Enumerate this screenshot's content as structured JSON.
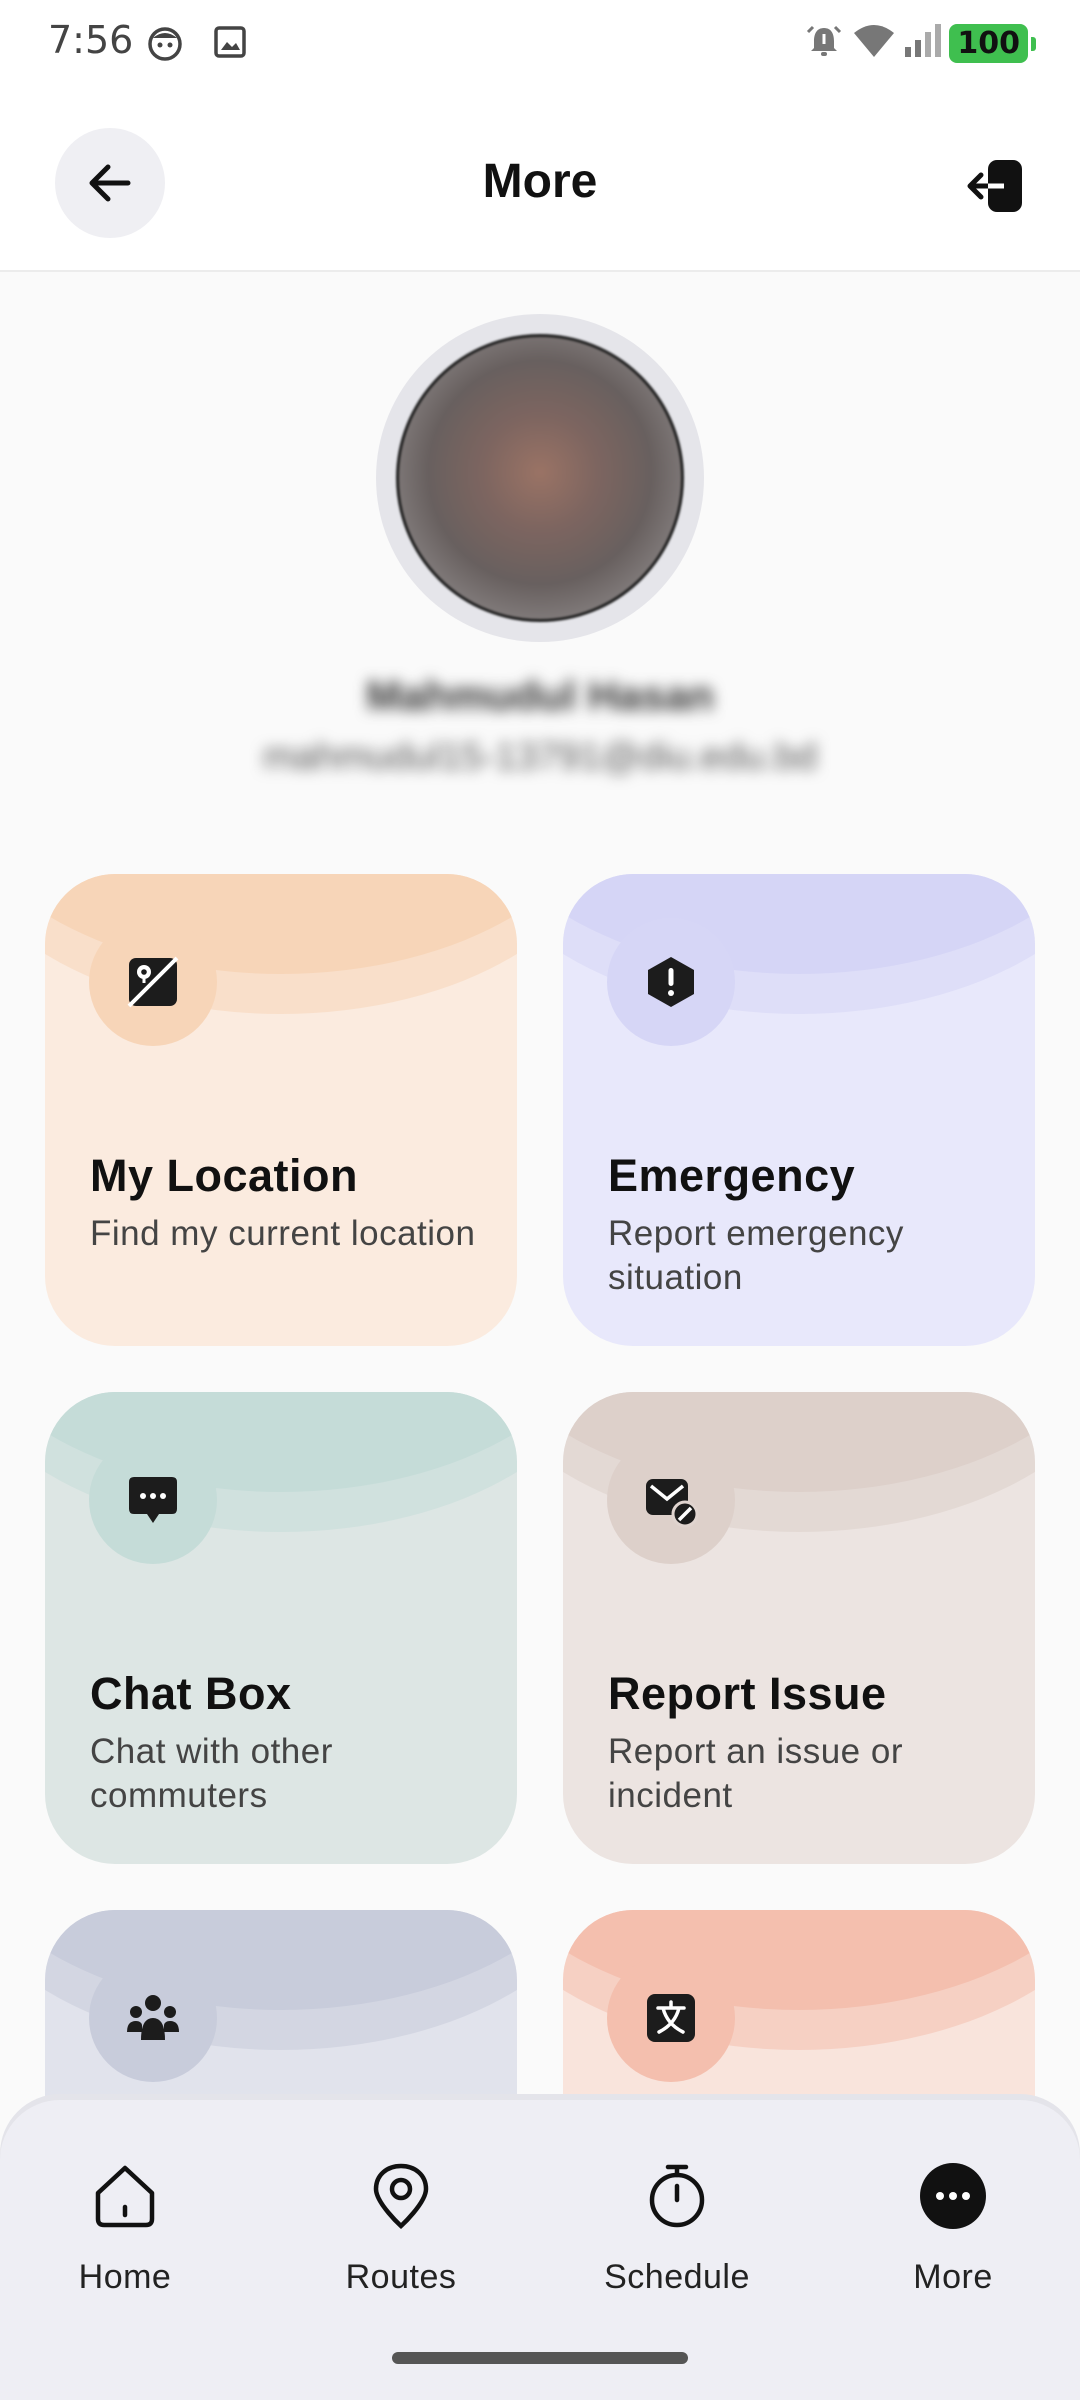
{
  "status_bar": {
    "time": "7:56",
    "battery": "100",
    "icons": [
      "face-icon",
      "image-icon",
      "alarm-icon",
      "wifi-icon",
      "signal-icon",
      "battery-icon"
    ]
  },
  "header": {
    "title": "More",
    "back_icon": "arrow-left-icon",
    "logout_icon": "logout-icon"
  },
  "profile": {
    "name": "Mahmudul Hasan",
    "email": "mahmudul15-13791@diu.edu.bd"
  },
  "cards": [
    {
      "title": "My Location",
      "description": "Find my current location",
      "icon": "location-map-icon",
      "bg": "#fbebdf",
      "accent": "#f7d5b8"
    },
    {
      "title": "Emergency",
      "description": "Report emergency situation",
      "icon": "alert-hexagon-icon",
      "bg": "#e8e8fb",
      "accent": "#d6d6f6"
    },
    {
      "title": "Chat Box",
      "description": "Chat with other commuters",
      "icon": "chat-bubble-icon",
      "bg": "#dde6e4",
      "accent": "#c5dcd8"
    },
    {
      "title": "Report Issue",
      "description": "Report an issue or incident",
      "icon": "report-envelope-icon",
      "bg": "#ece4e1",
      "accent": "#ddd0ca"
    },
    {
      "title": "",
      "description": "",
      "icon": "community-icon",
      "bg": "#e1e3ec",
      "accent": "#c8ccdb"
    },
    {
      "title": "",
      "description": "",
      "icon": "translate-icon",
      "bg": "#f9e4dc",
      "accent": "#f4bfae"
    }
  ],
  "bottom_nav": [
    {
      "label": "Home",
      "icon": "home-icon"
    },
    {
      "label": "Routes",
      "icon": "location-pin-icon"
    },
    {
      "label": "Schedule",
      "icon": "stopwatch-icon"
    },
    {
      "label": "More",
      "icon": "more-dots-icon"
    }
  ]
}
